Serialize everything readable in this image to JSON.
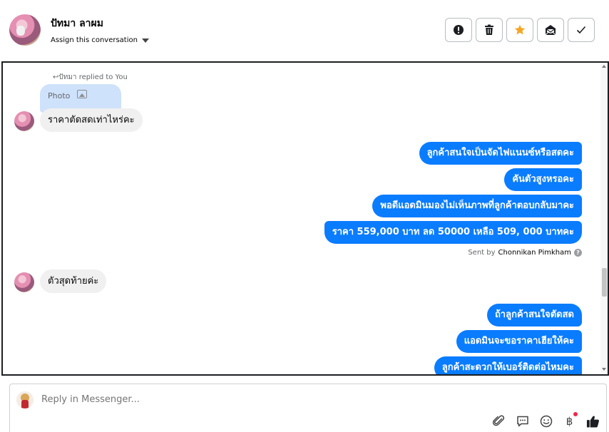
{
  "header": {
    "contact_name": "ปัทมา ลาผม",
    "assign_label": "Assign this conversation",
    "actions": [
      {
        "name": "mark-spam-button",
        "icon": "exclamation-icon"
      },
      {
        "name": "delete-button",
        "icon": "trash-icon"
      },
      {
        "name": "star-button",
        "icon": "star-icon",
        "color": "#f5a623"
      },
      {
        "name": "mark-unread-button",
        "icon": "envelope-icon"
      },
      {
        "name": "mark-done-button",
        "icon": "checkmark-icon"
      }
    ]
  },
  "conversation": {
    "reply_note": "ปัทมา replied to You",
    "photo_label": "Photo",
    "incoming": [
      {
        "text": "ราคาตัดสดเท่าไหร่คะ"
      },
      {
        "text": "ตัวสุดท้ายค่ะ"
      }
    ],
    "outgoing_group_1": [
      {
        "text": "ลูกค้าสนใจเป็นจัดไฟแนนซ์หรือสดคะ"
      },
      {
        "text": "คันตัวสูงหรอคะ"
      },
      {
        "text": "พอดีแอดมินมองไม่เห็นภาพที่ลูกค้าตอบกลับมาคะ"
      },
      {
        "text": "ราคา 559,000 บาท ลด 50000 เหลือ 509, 000 บาทคะ"
      }
    ],
    "sent_by_prefix": "Sent by",
    "sent_by_name": "Chonnikan Pimkham",
    "outgoing_group_2": [
      {
        "text": "ถ้าลูกค้าสนใจตัดสด"
      },
      {
        "text": "แอดมินจะขอราคาเฮียให้คะ"
      },
      {
        "text": "ลูกค้าสะดวกให้เบอร์ติดต่อไหมคะ"
      }
    ]
  },
  "composer": {
    "placeholder": "Reply in Messenger...",
    "tools": [
      "paperclip-icon",
      "speech-bubble-icon",
      "emoji-icon",
      "baht-icon",
      "thumbs-up-icon"
    ]
  },
  "colors": {
    "outgoing_bubble": "#0a7cff",
    "incoming_bubble": "#f0f0f0",
    "photo_bubble": "#cfe2fb",
    "star": "#f5a623"
  }
}
